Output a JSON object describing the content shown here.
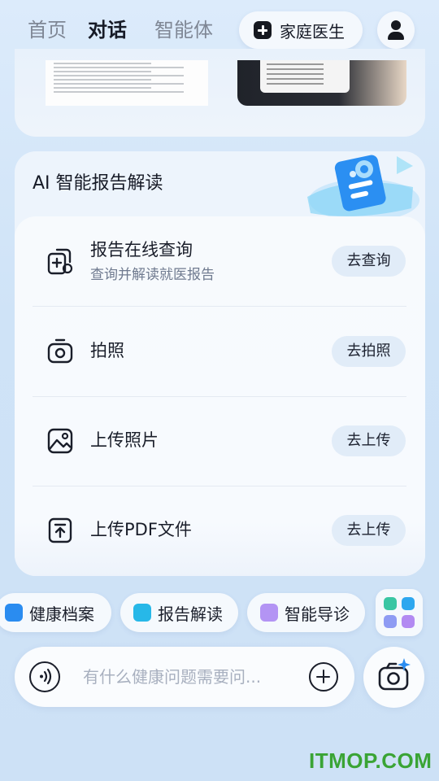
{
  "tabs": [
    {
      "label": "首页",
      "active": false
    },
    {
      "label": "对话",
      "active": true
    },
    {
      "label": "智能体",
      "active": false
    }
  ],
  "header": {
    "doctor_label": "家庭医生",
    "doctor_icon": "medical-cross-icon",
    "user_icon": "user-icon"
  },
  "report": {
    "title": "AI 智能报告解读",
    "items": [
      {
        "icon": "report-search-icon",
        "title": "报告在线查询",
        "subtitle": "查询并解读就医报告",
        "action": "去查询"
      },
      {
        "icon": "camera-icon",
        "title": "拍照",
        "subtitle": "",
        "action": "去拍照"
      },
      {
        "icon": "image-icon",
        "title": "上传照片",
        "subtitle": "",
        "action": "去上传"
      },
      {
        "icon": "upload-file-icon",
        "title": "上传PDF文件",
        "subtitle": "",
        "action": "去上传"
      }
    ]
  },
  "chips": [
    {
      "label": "健康档案",
      "icon": "folder-icon",
      "color": "#2a8cf0"
    },
    {
      "label": "报告解读",
      "icon": "report-chat-icon",
      "color": "#27b8e8"
    },
    {
      "label": "智能导诊",
      "icon": "guide-search-icon",
      "color": "#9b6cf0"
    }
  ],
  "input": {
    "placeholder": "有什么健康问题需要问...",
    "value": ""
  },
  "watermark": "ITMOP.COM",
  "colors": {
    "accent": "#2a8cf0",
    "action_bg": "#e1ecf8",
    "watermark": "#3aa435"
  }
}
